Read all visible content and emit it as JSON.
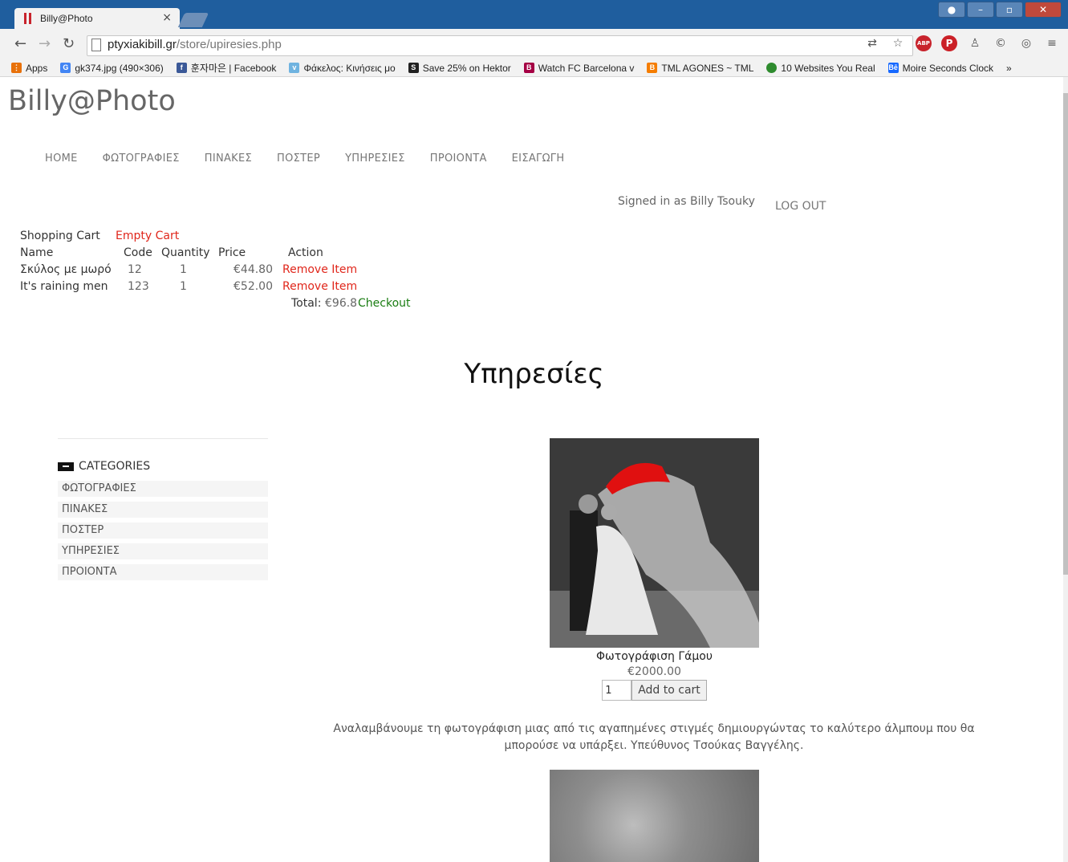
{
  "browser": {
    "tab_title": "Billy@Photo",
    "tab_close": "×",
    "url_host": "ptyxiakibill.gr",
    "url_path": "/store/upiresies.php",
    "bookmarks": [
      {
        "label": "Apps",
        "icon": "apps-grid-icon",
        "color": "#e8710a"
      },
      {
        "label": "gk374.jpg (490×306)",
        "icon": "google-icon",
        "color": "#4285f4"
      },
      {
        "label": "훈자마은 | Facebook",
        "icon": "facebook-icon",
        "color": "#3b5998"
      },
      {
        "label": "Φάκελος: Κινήσεις μο",
        "icon": "folder-site-icon",
        "color": "#6fb3e0"
      },
      {
        "label": "Save 25% on Hektor",
        "icon": "steam-icon",
        "color": "#222222"
      },
      {
        "label": "Watch FC Barcelona v",
        "icon": "barcelona-icon",
        "color": "#a50044"
      },
      {
        "label": "TML AGONES ~ TML",
        "icon": "blogger-icon",
        "color": "#f57d00"
      },
      {
        "label": "10 Websites You Real",
        "icon": "green-dot-icon",
        "color": "#2e8b2e"
      },
      {
        "label": "Moire Seconds Clock",
        "icon": "behance-icon",
        "color": "#1769ff"
      }
    ],
    "bookmarks_more": "»"
  },
  "site": {
    "brand": "Billy@Photo",
    "nav": [
      "HOME",
      "ΦΩΤΟΓΡΑΦΙΕΣ",
      "ΠΙΝΑΚΕΣ",
      "ΠΟΣΤΕΡ",
      "ΥΠΗΡΕΣΙΕΣ",
      "ΠΡΟΙΟΝΤΑ",
      "ΕΙΣΑΓΩΓΗ"
    ],
    "signed_in": "Signed in as Billy Tsouky",
    "logout": "LOG OUT"
  },
  "cart": {
    "title": "Shopping Cart",
    "empty_label": "Empty Cart",
    "headers": {
      "name": "Name",
      "code": "Code",
      "quantity": "Quantity",
      "price": "Price",
      "action": "Action"
    },
    "items": [
      {
        "name": "Σκύλος με μωρό",
        "code": "12",
        "quantity": "1",
        "price": "€44.80",
        "action": "Remove Item"
      },
      {
        "name": "It's raining men",
        "code": "123",
        "quantity": "1",
        "price": "€52.00",
        "action": "Remove Item"
      }
    ],
    "total_label": "Total:",
    "total_value": "€96.8",
    "checkout": "Checkout"
  },
  "page": {
    "heading": "Υπηρεσίες"
  },
  "sidebar": {
    "title": "CATEGORIES",
    "items": [
      "ΦΩΤΟΓΡΑΦΙΕΣ",
      "ΠΙΝΑΚΕΣ",
      "ΠΟΣΤΕΡ",
      "ΥΠΗΡΕΣΙΕΣ",
      "ΠΡΟΙΟΝΤΑ"
    ]
  },
  "product": {
    "title": "Φωτογράφιση Γάμου",
    "price": "€2000.00",
    "qty_value": "1",
    "add_to_cart": "Add to cart",
    "description": "Αναλαμβάνουμε τη φωτογράφιση μιας από τις αγαπημένες στιγμές δημιουργώντας το καλύτερο άλμπουμ που θα μπορούσε να υπάρξει. Υπεύθυνος Τσούκας Βαγγέλης."
  },
  "colors": {
    "link_red": "#e0261b",
    "checkout_green": "#1a7d12",
    "chrome_blue": "#1f5e9e",
    "umbrella_red": "#e01010"
  }
}
